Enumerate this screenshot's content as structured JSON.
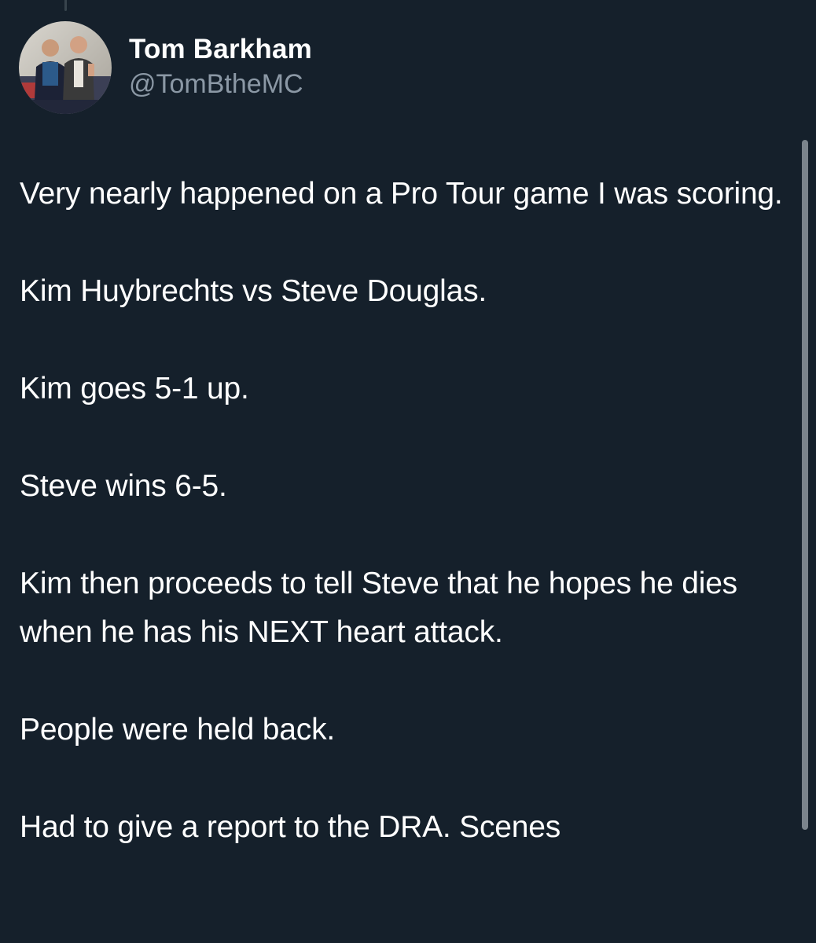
{
  "tweet": {
    "author": {
      "display_name": "Tom Barkham",
      "handle": "@TomBtheMC"
    },
    "paragraphs": [
      "Very nearly happened on a Pro Tour game I was scoring.",
      "Kim Huybrechts vs Steve Douglas.",
      "Kim goes 5-1 up.",
      "Steve wins 6-5.",
      "Kim then proceeds to tell Steve that he hopes he dies when he has his NEXT heart attack.",
      "People were held back.",
      "Had to give a report to the DRA. Scenes"
    ]
  },
  "colors": {
    "background": "#15202b",
    "text_primary": "#ffffff",
    "text_secondary": "#8b98a5",
    "scrollbar": "#7b848c"
  }
}
